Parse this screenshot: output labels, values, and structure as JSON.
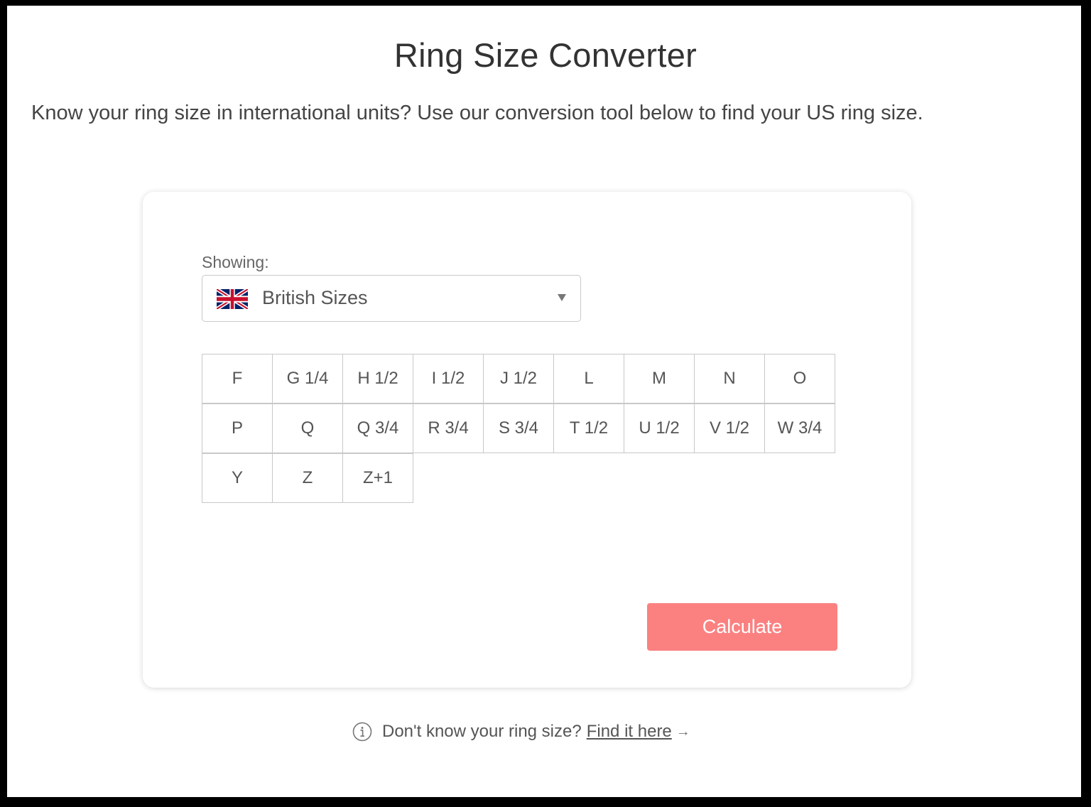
{
  "page": {
    "title": "Ring Size Converter",
    "subtitle": "Know your ring size in international units? Use our conversion tool below to find your US ring size."
  },
  "converter": {
    "showing_label": "Showing:",
    "select": {
      "value": "British Sizes",
      "flag_icon": "uk-flag-icon",
      "dropdown_icon": "caret-down-icon"
    },
    "size_rows": [
      [
        "F",
        "G 1/4",
        "H 1/2",
        "I 1/2",
        "J 1/2",
        "L",
        "M",
        "N",
        "O"
      ],
      [
        "P",
        "Q",
        "Q 3/4",
        "R 3/4",
        "S 3/4",
        "T 1/2",
        "U 1/2",
        "V 1/2",
        "W 3/4"
      ],
      [
        "Y",
        "Z",
        "Z+1"
      ]
    ],
    "calculate_label": "Calculate",
    "accent_color": "#fb8181"
  },
  "help": {
    "icon": "info-icon",
    "text": "Don't know your ring size?",
    "link_label": "Find it here",
    "arrow": "→"
  }
}
